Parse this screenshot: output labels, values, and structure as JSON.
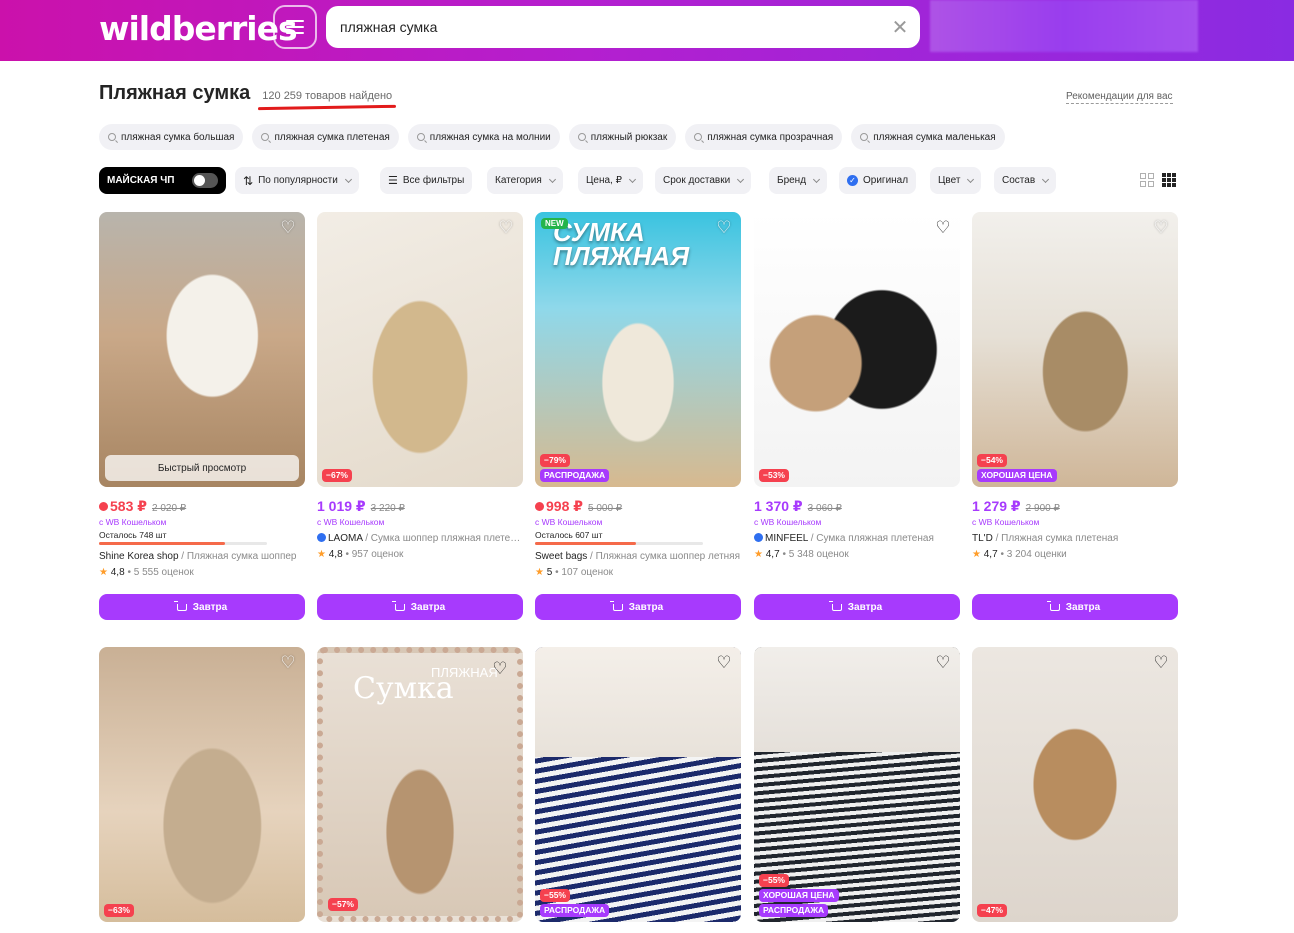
{
  "header": {
    "logo": "wildberries",
    "search_value": "пляжная сумка",
    "clear_symbol": "✕"
  },
  "page": {
    "title": "Пляжная сумка",
    "found": "120 259 товаров найдено",
    "recommendations": "Рекомендации для вас"
  },
  "suggestions": [
    "пляжная сумка большая",
    "пляжная сумка плетеная",
    "пляжная сумка на молнии",
    "пляжный рюкзак",
    "пляжная сумка прозрачная",
    "пляжная сумка маленькая"
  ],
  "filters": {
    "may": "МАЙСКАЯ ЧП",
    "sort": "По популярности",
    "all": "Все фильтры",
    "category": "Категория",
    "price": "Цена, ₽",
    "delivery": "Срок доставки",
    "brand": "Бренд",
    "original": "Оригинал",
    "color": "Цвет",
    "composition": "Состав"
  },
  "ui": {
    "quick_view": "Быстрый просмотр",
    "wallet": "с WB Кошельком",
    "buy_label": "Завтра",
    "heart": "♡",
    "star": "★",
    "bullet": "•"
  },
  "products": [
    {
      "price": "583 ₽",
      "old_price": "2 020 ₽",
      "price_red": true,
      "left": "Осталось 748 шт",
      "stock_level": 0.75,
      "brand": "Shine Korea shop",
      "name": " / Пляжная сумка шоппер",
      "rating": "4,8",
      "reviews": "5 555 оценок"
    },
    {
      "price": "1 019 ₽",
      "old_price": "3 220 ₽",
      "discount": "−67%",
      "brand": "LAOMA",
      "name": " / Сумка шоппер пляжная плетеная",
      "rating": "4,8",
      "reviews": "957 оценок"
    },
    {
      "price": "998 ₽",
      "old_price": "5 000 ₽",
      "price_red": true,
      "discount": "−79%",
      "sale": "РАСПРОДАЖА",
      "new": "NEW",
      "img_title": "СУМКА ПЛЯЖНАЯ",
      "left": "Осталось 607 шт",
      "stock_level": 0.6,
      "brand": "Sweet bags",
      "name": " / Пляжная сумка шоппер летняя",
      "rating": "5",
      "reviews": "107 оценок"
    },
    {
      "price": "1 370 ₽",
      "old_price": "3 060 ₽",
      "discount": "−53%",
      "brand": "MINFEEL",
      "name": " / Сумка пляжная плетеная",
      "rating": "4,7",
      "reviews": "5 348 оценок"
    },
    {
      "price": "1 279 ₽",
      "old_price": "2 900 ₽",
      "discount": "−54%",
      "good": "ХОРОШАЯ ЦЕНА",
      "brand": "TL'D",
      "name": " / Пляжная сумка плетеная",
      "rating": "4,7",
      "reviews": "3 204 оценки"
    }
  ],
  "products_row2": [
    {
      "discount": "−63%"
    },
    {
      "discount": "−57%",
      "img_title": "Сумка",
      "img_sub": "ПЛЯЖНАЯ"
    },
    {
      "discount": "−55%",
      "sale": "РАСПРОДАЖА"
    },
    {
      "discount": "−55%",
      "good": "ХОРОШАЯ ЦЕНА",
      "sale": "РАСПРОДАЖА"
    },
    {
      "discount": "−47%"
    }
  ]
}
